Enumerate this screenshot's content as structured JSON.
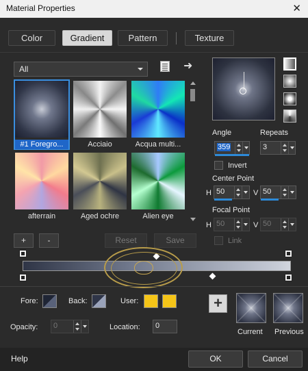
{
  "window": {
    "title": "Material Properties",
    "close_glyph": "✕"
  },
  "tabs": [
    {
      "label": "Color",
      "active": false
    },
    {
      "label": "Gradient",
      "active": true
    },
    {
      "label": "Pattern",
      "active": false
    },
    {
      "label": "Texture",
      "active": false
    }
  ],
  "category": {
    "selected": "All"
  },
  "gallery": [
    {
      "label": "#1 Foregro...",
      "selected": true
    },
    {
      "label": "Acciaio",
      "selected": false
    },
    {
      "label": "Acqua multi...",
      "selected": false
    },
    {
      "label": "afterrain",
      "selected": false
    },
    {
      "label": "Aged ochre",
      "selected": false
    },
    {
      "label": "Alien eye",
      "selected": false
    }
  ],
  "gallery_buttons": {
    "add": "+",
    "remove": "-",
    "reset": "Reset",
    "save": "Save"
  },
  "angle": {
    "label": "Angle",
    "value": "359"
  },
  "repeats": {
    "label": "Repeats",
    "value": "3"
  },
  "invert": {
    "label": "Invert",
    "checked": false
  },
  "center_point": {
    "label": "Center Point",
    "h_label": "H",
    "h_value": "50",
    "v_label": "V",
    "v_value": "50"
  },
  "focal_point": {
    "label": "Focal Point",
    "h_label": "H",
    "h_value": "50",
    "v_label": "V",
    "v_value": "50",
    "enabled": false
  },
  "link": {
    "label": "Link",
    "checked": false
  },
  "stops": {
    "fore_label": "Fore:",
    "back_label": "Back:",
    "user_label": "User:",
    "user_color": "#f5c518",
    "opacity_label": "Opacity:",
    "opacity_value": "0",
    "location_label": "Location:",
    "location_value": "0"
  },
  "swatches": {
    "add_glyph": "+",
    "current_label": "Current",
    "previous_label": "Previous"
  },
  "footer": {
    "help": "Help",
    "ok": "OK",
    "cancel": "Cancel"
  },
  "colors": {
    "accent": "#1f66c8",
    "selection_border": "#3a8fe0",
    "gold": "#f5c518",
    "dialog_bg": "#2b2b2b"
  }
}
